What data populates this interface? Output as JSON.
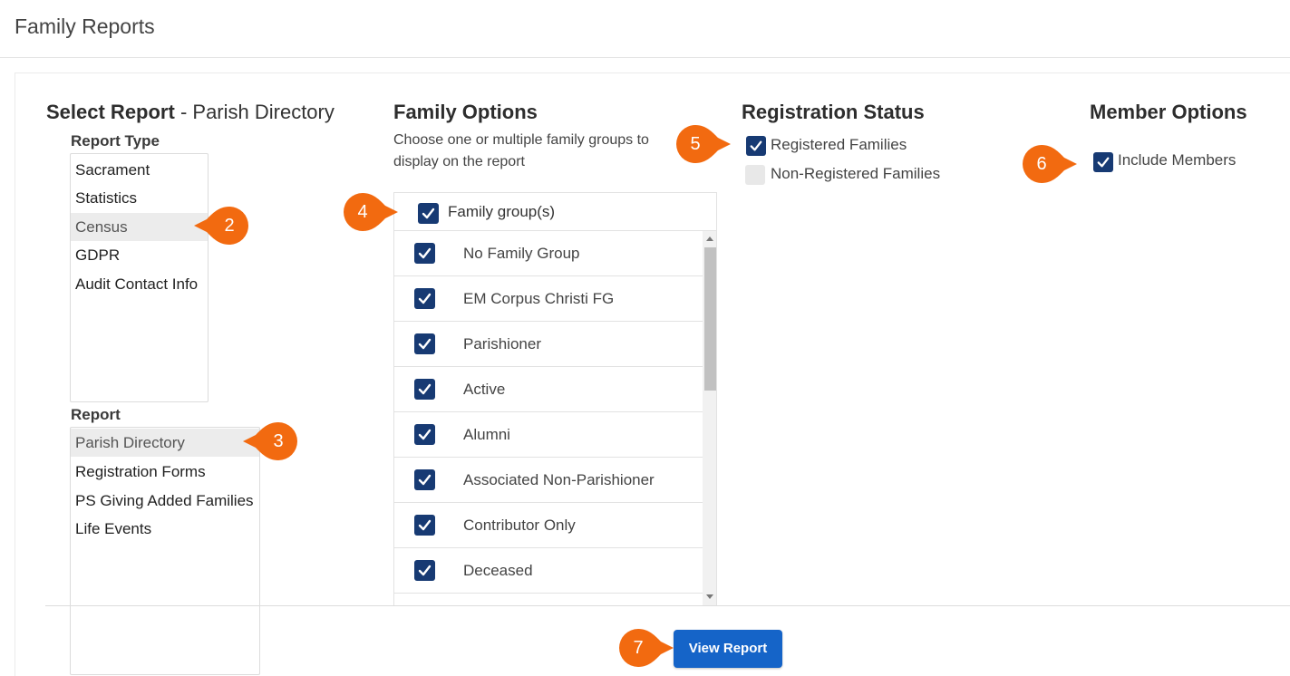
{
  "page": {
    "title": "Family Reports"
  },
  "select_report": {
    "heading": "Select Report",
    "separator": " - ",
    "current": "Parish Directory",
    "report_type_label": "Report Type",
    "report_types": [
      "Sacrament",
      "Statistics",
      "Census",
      "GDPR",
      "Audit Contact Info"
    ],
    "report_type_selected": "Census",
    "report_label": "Report",
    "reports": [
      "Parish Directory",
      "Registration Forms",
      "PS Giving Added Families",
      "Life Events"
    ],
    "report_selected": "Parish Directory"
  },
  "family_options": {
    "heading": "Family Options",
    "description": "Choose one or multiple family groups to display on the report",
    "all_label": "Family group(s)",
    "all_checked": true,
    "groups": [
      {
        "label": "No Family Group",
        "checked": true
      },
      {
        "label": "EM Corpus Christi FG",
        "checked": true
      },
      {
        "label": "Parishioner",
        "checked": true
      },
      {
        "label": "Active",
        "checked": true
      },
      {
        "label": "Alumni",
        "checked": true
      },
      {
        "label": "Associated Non-Parishioner",
        "checked": true
      },
      {
        "label": "Contributor Only",
        "checked": true
      },
      {
        "label": "Deceased",
        "checked": true
      }
    ]
  },
  "registration_status": {
    "heading": "Registration Status",
    "options": [
      {
        "label": "Registered Families",
        "checked": true
      },
      {
        "label": "Non-Registered Families",
        "checked": false
      }
    ]
  },
  "member_options": {
    "heading": "Member Options",
    "include_members_label": "Include Members",
    "include_members_checked": true
  },
  "actions": {
    "view_report_label": "View Report"
  },
  "callouts": [
    "2",
    "3",
    "4",
    "5",
    "6",
    "7"
  ],
  "colors": {
    "accent": "#1564c8",
    "checkbox": "#173a73",
    "callout": "#f26a10"
  }
}
